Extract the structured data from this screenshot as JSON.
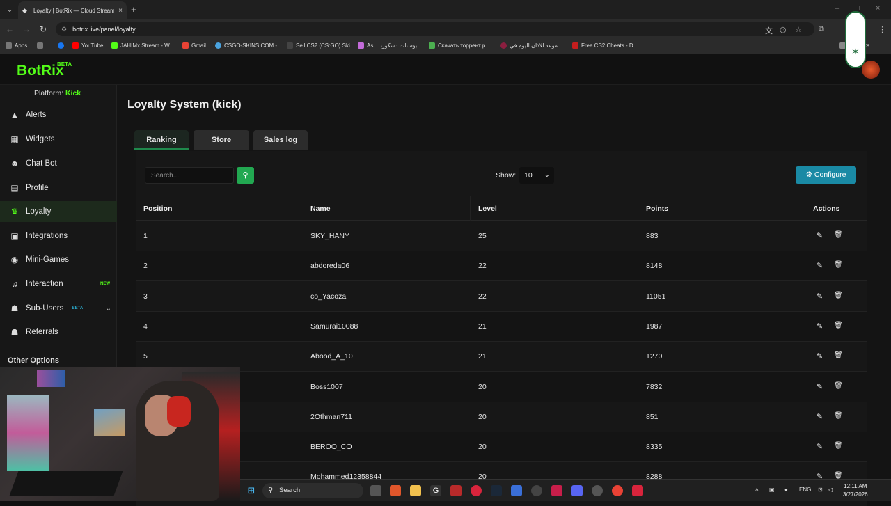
{
  "browser": {
    "tab_title": "Loyalty | BotRix — Cloud Stream",
    "url": "botrix.live/panel/loyalty",
    "bookmarks": [
      {
        "label": "Apps",
        "color": "#888888"
      },
      {
        "label": "",
        "color": "#888888"
      },
      {
        "label": "",
        "color": "#1877f2"
      },
      {
        "label": "YouTube",
        "color": "#ff0000"
      },
      {
        "label": "JAHIMx Stream - W...",
        "color": "#53fc18"
      },
      {
        "label": "Gmail",
        "color": "#ea4335"
      },
      {
        "label": "CSGO-SKINS.COM -...",
        "color": "#4aa3df"
      },
      {
        "label": "Sell CS2 (CS:GO) Ski...",
        "color": "#444444"
      },
      {
        "label": "As... بوستات دسكورد",
        "color": "#c36bd9"
      },
      {
        "label": "Скачать торрент р...",
        "color": "#4caf50"
      },
      {
        "label": "موعد الاذان اليوم في...",
        "color": "#8b1e3f"
      },
      {
        "label": "Free CS2 Cheats - D...",
        "color": "#c41e1e"
      }
    ],
    "bookmarks_overflow": "okmarks"
  },
  "app": {
    "logo": "BotRix",
    "logo_badge": "BETA",
    "platform_label": "Platform:",
    "platform_value": "Kick",
    "nav": [
      {
        "label": "Alerts",
        "icon": "warning-icon",
        "glyph": "▲"
      },
      {
        "label": "Widgets",
        "icon": "grid-icon",
        "glyph": "▦"
      },
      {
        "label": "Chat Bot",
        "icon": "robot-icon",
        "glyph": "☻"
      },
      {
        "label": "Profile",
        "icon": "id-card-icon",
        "glyph": "▤"
      },
      {
        "label": "Loyalty",
        "icon": "trophy-icon",
        "glyph": "♛",
        "active": true
      },
      {
        "label": "Integrations",
        "icon": "plug-icon",
        "glyph": "▣"
      },
      {
        "label": "Mini-Games",
        "icon": "gamepad-icon",
        "glyph": "◉"
      },
      {
        "label": "Interaction",
        "icon": "music-icon",
        "glyph": "♫",
        "tag": "NEW"
      },
      {
        "label": "Sub-Users",
        "icon": "users-icon",
        "glyph": "☗",
        "tag": "BETA"
      },
      {
        "label": "Referrals",
        "icon": "user-plus-icon",
        "glyph": "☗"
      }
    ],
    "other_options": "Other Options"
  },
  "page": {
    "title": "Loyalty System (kick)",
    "tabs": [
      "Ranking",
      "Store",
      "Sales log"
    ],
    "search_placeholder": "Search...",
    "show_label": "Show:",
    "show_value": "10",
    "configure_label": "Configure",
    "columns": [
      "Position",
      "Name",
      "Level",
      "Points",
      "Actions"
    ],
    "rows": [
      {
        "position": "1",
        "name": "SKY_HANY",
        "level": "25",
        "points": "883"
      },
      {
        "position": "2",
        "name": "abdoreda06",
        "level": "22",
        "points": "8148"
      },
      {
        "position": "3",
        "name": "co_Yacoza",
        "level": "22",
        "points": "11051"
      },
      {
        "position": "4",
        "name": "Samurai10088",
        "level": "21",
        "points": "1987"
      },
      {
        "position": "5",
        "name": "Abood_A_10",
        "level": "21",
        "points": "1270"
      },
      {
        "position": "",
        "name": "Boss1007",
        "level": "20",
        "points": "7832"
      },
      {
        "position": "",
        "name": "2Othman711",
        "level": "20",
        "points": "851"
      },
      {
        "position": "",
        "name": "BEROO_CO",
        "level": "20",
        "points": "8335"
      },
      {
        "position": "",
        "name": "Mohammed12358844",
        "level": "20",
        "points": "8288"
      }
    ]
  },
  "taskbar": {
    "search_label": "Search",
    "lang": "ENG",
    "time": "12:11 AM",
    "date": "3/27/2026"
  },
  "colors": {
    "brand_green": "#53fc18",
    "configure_teal": "#1a8aa5",
    "search_button_green": "#22a851"
  }
}
